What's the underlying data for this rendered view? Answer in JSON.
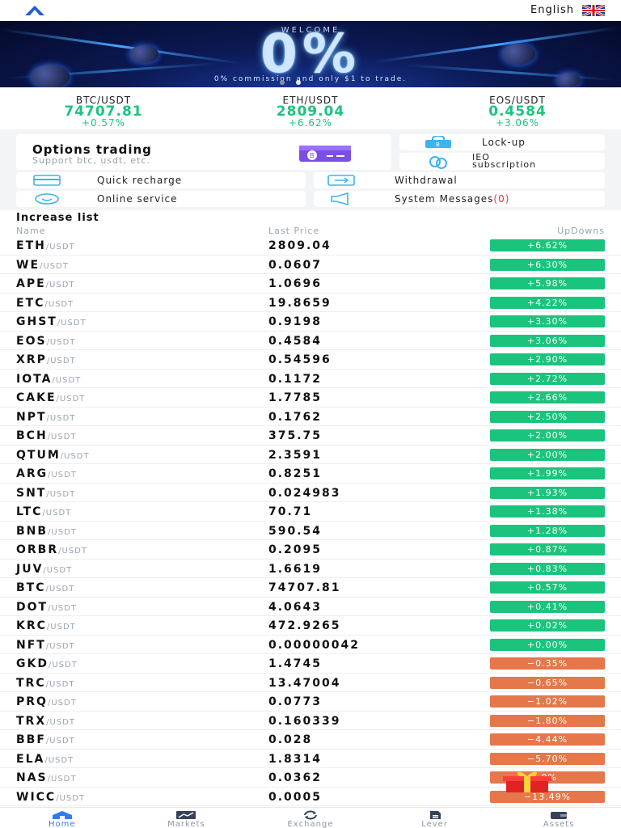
{
  "header": {
    "language": "English"
  },
  "banner": {
    "welcome": "WELCOME",
    "headline": "0%",
    "subtitle": "0% commission and only $1 to trade."
  },
  "tickers": [
    {
      "pair": "BTC/USDT",
      "price": "74707.81",
      "change": "+0.57%"
    },
    {
      "pair": "ETH/USDT",
      "price": "2809.04",
      "change": "+6.62%"
    },
    {
      "pair": "EOS/USDT",
      "price": "0.4584",
      "change": "+3.06%"
    }
  ],
  "options": {
    "title": "Options trading",
    "subtitle": "Support btc, usdt, etc."
  },
  "lockup": {
    "label": "Lock-up"
  },
  "ieo": {
    "line1": "IEO",
    "line2": "subscription"
  },
  "quick_recharge": {
    "label": "Quick recharge"
  },
  "withdrawal": {
    "label": "Withdrawal"
  },
  "online_service": {
    "label": "Online service"
  },
  "system_messages": {
    "label": "System Messages",
    "count": "(0)"
  },
  "colors": {
    "up": "#1bc47d",
    "down": "#e5774a",
    "accent": "#2d7cf6"
  },
  "increase_list": {
    "title": "Increase list",
    "columns": {
      "name": "Name",
      "last_price": "Last Price",
      "updowns": "UpDowns"
    },
    "rows": [
      {
        "base": "ETH",
        "quote": "/USDT",
        "price": "2809.04",
        "change": "+6.62%",
        "dir": "up"
      },
      {
        "base": "WE",
        "quote": "/USDT",
        "price": "0.0607",
        "change": "+6.30%",
        "dir": "up"
      },
      {
        "base": "APE",
        "quote": "/USDT",
        "price": "1.0696",
        "change": "+5.98%",
        "dir": "up"
      },
      {
        "base": "ETC",
        "quote": "/USDT",
        "price": "19.8659",
        "change": "+4.22%",
        "dir": "up"
      },
      {
        "base": "GHST",
        "quote": "/USDT",
        "price": "0.9198",
        "change": "+3.30%",
        "dir": "up"
      },
      {
        "base": "EOS",
        "quote": "/USDT",
        "price": "0.4584",
        "change": "+3.06%",
        "dir": "up"
      },
      {
        "base": "XRP",
        "quote": "/USDT",
        "price": "0.54596",
        "change": "+2.90%",
        "dir": "up"
      },
      {
        "base": "IOTA",
        "quote": "/USDT",
        "price": "0.1172",
        "change": "+2.72%",
        "dir": "up"
      },
      {
        "base": "CAKE",
        "quote": "/USDT",
        "price": "1.7785",
        "change": "+2.66%",
        "dir": "up"
      },
      {
        "base": "NPT",
        "quote": "/USDT",
        "price": "0.1762",
        "change": "+2.50%",
        "dir": "up"
      },
      {
        "base": "BCH",
        "quote": "/USDT",
        "price": "375.75",
        "change": "+2.00%",
        "dir": "up"
      },
      {
        "base": "QTUM",
        "quote": "/USDT",
        "price": "2.3591",
        "change": "+2.00%",
        "dir": "up"
      },
      {
        "base": "ARG",
        "quote": "/USDT",
        "price": "0.8251",
        "change": "+1.99%",
        "dir": "up"
      },
      {
        "base": "SNT",
        "quote": "/USDT",
        "price": "0.024983",
        "change": "+1.93%",
        "dir": "up"
      },
      {
        "base": "LTC",
        "quote": "/USDT",
        "price": "70.71",
        "change": "+1.38%",
        "dir": "up"
      },
      {
        "base": "BNB",
        "quote": "/USDT",
        "price": "590.54",
        "change": "+1.28%",
        "dir": "up"
      },
      {
        "base": "ORBR",
        "quote": "/USDT",
        "price": "0.2095",
        "change": "+0.87%",
        "dir": "up"
      },
      {
        "base": "JUV",
        "quote": "/USDT",
        "price": "1.6619",
        "change": "+0.83%",
        "dir": "up"
      },
      {
        "base": "BTC",
        "quote": "/USDT",
        "price": "74707.81",
        "change": "+0.57%",
        "dir": "up"
      },
      {
        "base": "DOT",
        "quote": "/USDT",
        "price": "4.0643",
        "change": "+0.41%",
        "dir": "up"
      },
      {
        "base": "KRC",
        "quote": "/USDT",
        "price": "472.9265",
        "change": "+0.02%",
        "dir": "up"
      },
      {
        "base": "NFT",
        "quote": "/USDT",
        "price": "0.00000042",
        "change": "+0.00%",
        "dir": "up"
      },
      {
        "base": "GKD",
        "quote": "/USDT",
        "price": "1.4745",
        "change": "−0.35%",
        "dir": "down"
      },
      {
        "base": "TRC",
        "quote": "/USDT",
        "price": "13.47004",
        "change": "−0.65%",
        "dir": "down"
      },
      {
        "base": "PRQ",
        "quote": "/USDT",
        "price": "0.0773",
        "change": "−1.02%",
        "dir": "down"
      },
      {
        "base": "TRX",
        "quote": "/USDT",
        "price": "0.160339",
        "change": "−1.80%",
        "dir": "down"
      },
      {
        "base": "BBF",
        "quote": "/USDT",
        "price": "0.028",
        "change": "−4.44%",
        "dir": "down"
      },
      {
        "base": "ELA",
        "quote": "/USDT",
        "price": "1.8314",
        "change": "−5.70%",
        "dir": "down"
      },
      {
        "base": "NAS",
        "quote": "/USDT",
        "price": "0.0362",
        "change": ".0%",
        "dir": "down"
      },
      {
        "base": "WICC",
        "quote": "/USDT",
        "price": "0.0005",
        "change": "−13.49%",
        "dir": "down"
      }
    ]
  },
  "bottom_nav": [
    {
      "label": "Home",
      "icon": "home-icon",
      "active": true
    },
    {
      "label": "Markets",
      "icon": "chart-icon",
      "active": false
    },
    {
      "label": "Exchange",
      "icon": "exchange-icon",
      "active": false
    },
    {
      "label": "Lever",
      "icon": "document-icon",
      "active": false
    },
    {
      "label": "Assets",
      "icon": "wallet-icon",
      "active": false
    }
  ]
}
